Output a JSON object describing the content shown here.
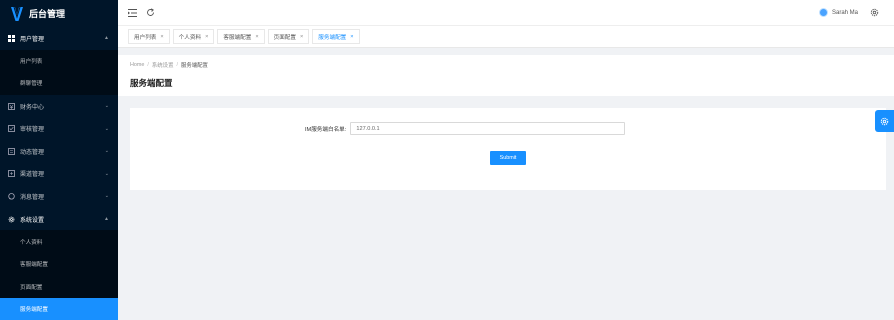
{
  "app": {
    "title": "后台管理",
    "accent": "#1890ff",
    "sidebar_bg": "#001529"
  },
  "sidebar": {
    "groups": [
      {
        "label": "用户管理",
        "icon": "grid-icon",
        "open": true,
        "children": [
          "用户列表",
          "群聊管理"
        ]
      },
      {
        "label": "财务中心",
        "icon": "finance-icon",
        "open": false
      },
      {
        "label": "审核管理",
        "icon": "audit-icon",
        "open": false
      },
      {
        "label": "动态管理",
        "icon": "feed-icon",
        "open": false
      },
      {
        "label": "渠道管理",
        "icon": "channel-icon",
        "open": false
      },
      {
        "label": "消息管理",
        "icon": "message-icon",
        "open": false
      },
      {
        "label": "系统设置",
        "icon": "gear-icon",
        "open": true,
        "children": [
          "个人资料",
          "客服端配置",
          "页面配置",
          "服务端配置"
        ],
        "active_child": "服务端配置"
      }
    ]
  },
  "header": {
    "user_name": "Sarah Ma"
  },
  "tabs": [
    {
      "label": "用户列表",
      "active": false
    },
    {
      "label": "个人资料",
      "active": false
    },
    {
      "label": "客服端配置",
      "active": false
    },
    {
      "label": "页面配置",
      "active": false
    },
    {
      "label": "服务端配置",
      "active": true
    }
  ],
  "breadcrumb": {
    "home": "Home",
    "parent": "系统设置",
    "current": "服务端配置"
  },
  "page": {
    "title": "服务端配置"
  },
  "form": {
    "ip_label": "IM服务端白名单:",
    "ip_value": "127.0.0.1",
    "submit_label": "Submit"
  }
}
